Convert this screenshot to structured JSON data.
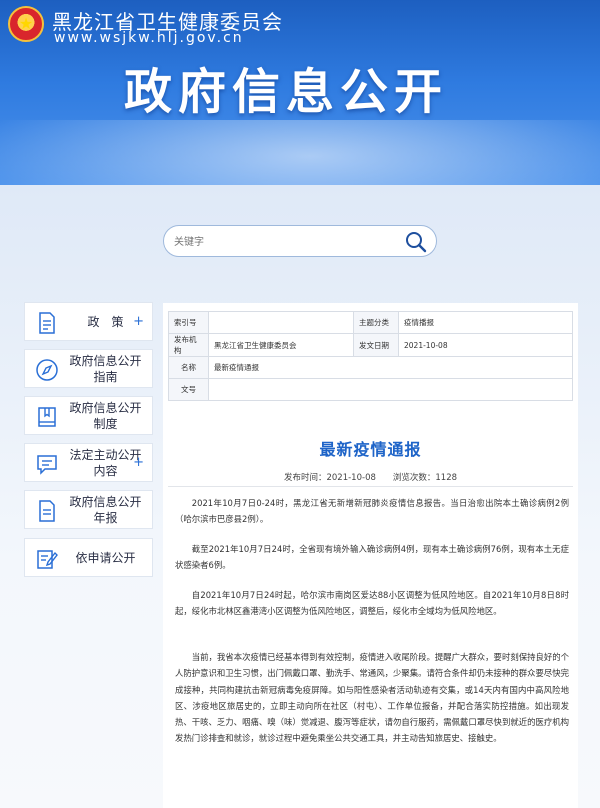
{
  "header": {
    "site_name": "黑龙江省卫生健康委员会",
    "site_url": "www.wsjkw.hlj.gov.cn",
    "page_title": "政府信息公开"
  },
  "search": {
    "placeholder": "关键字"
  },
  "sidebar": {
    "items": [
      {
        "label": "政　策",
        "icon": "document-icon",
        "plus": "+"
      },
      {
        "label": "政府信息公开指南",
        "icon": "compass-icon",
        "plus": ""
      },
      {
        "label": "政府信息公开制度",
        "icon": "book-icon",
        "plus": ""
      },
      {
        "label": "法定主动公开内容",
        "icon": "chat-list-icon",
        "plus": "+"
      },
      {
        "label": "政府信息公开年报",
        "icon": "report-icon",
        "plus": ""
      },
      {
        "label": "依申请公开",
        "icon": "application-icon",
        "plus": ""
      }
    ]
  },
  "meta": {
    "index_label": "索引号",
    "index_value": "",
    "category_label": "主题分类",
    "category_value": "疫情播报",
    "publisher_label": "发布机构",
    "publisher_value": "黑龙江省卫生健康委员会",
    "date_label": "发文日期",
    "date_value": "2021-10-08",
    "name_label": "名称",
    "name_value": "最新疫情通报",
    "docno_label": "文号",
    "docno_value": ""
  },
  "article": {
    "title": "最新疫情通报",
    "publish_info": "发布时间：2021-10-08　　浏览次数：1128",
    "paragraphs": [
      "2021年10月7日0-24时，黑龙江省无新增新冠肺炎疫情信息报告。当日治愈出院本土确诊病例2例（哈尔滨市巴彦县2例）。",
      "截至2021年10月7日24时，全省现有境外输入确诊病例4例，现有本土确诊病例76例，现有本土无症状感染者6例。",
      "自2021年10月7日24时起，哈尔滨市南岗区爱达88小区调整为低风险地区。自2021年10月8日8时起，绥化市北林区鑫港湾小区调整为低风险地区，调整后，绥化市全域均为低风险地区。",
      "当前，我省本次疫情已经基本得到有效控制，疫情进入收尾阶段。提醒广大群众，要时刻保持良好的个人防护意识和卫生习惯，出门佩戴口罩、勤洗手、常通风，少聚集。请符合条件却仍未接种的群众要尽快完成接种，共同构建抗击新冠病毒免疫屏障。如与阳性感染者活动轨迹有交集，或14天内有国内中高风险地区、涉疫地区旅居史的，立即主动向所在社区（村屯）、工作单位报备，并配合落实防控措施。如出现发热、干咳、乏力、咽痛、嗅（味）觉减退、腹泻等症状，请勿自行服药，需佩戴口罩尽快到就近的医疗机构发热门诊排查和就诊，就诊过程中避免乘坐公共交通工具，并主动告知旅居史、接触史。"
    ]
  },
  "colors": {
    "banner": "#2f7be0",
    "title_blue": "#1e64c8",
    "icon_blue": "#2a6fd6"
  }
}
